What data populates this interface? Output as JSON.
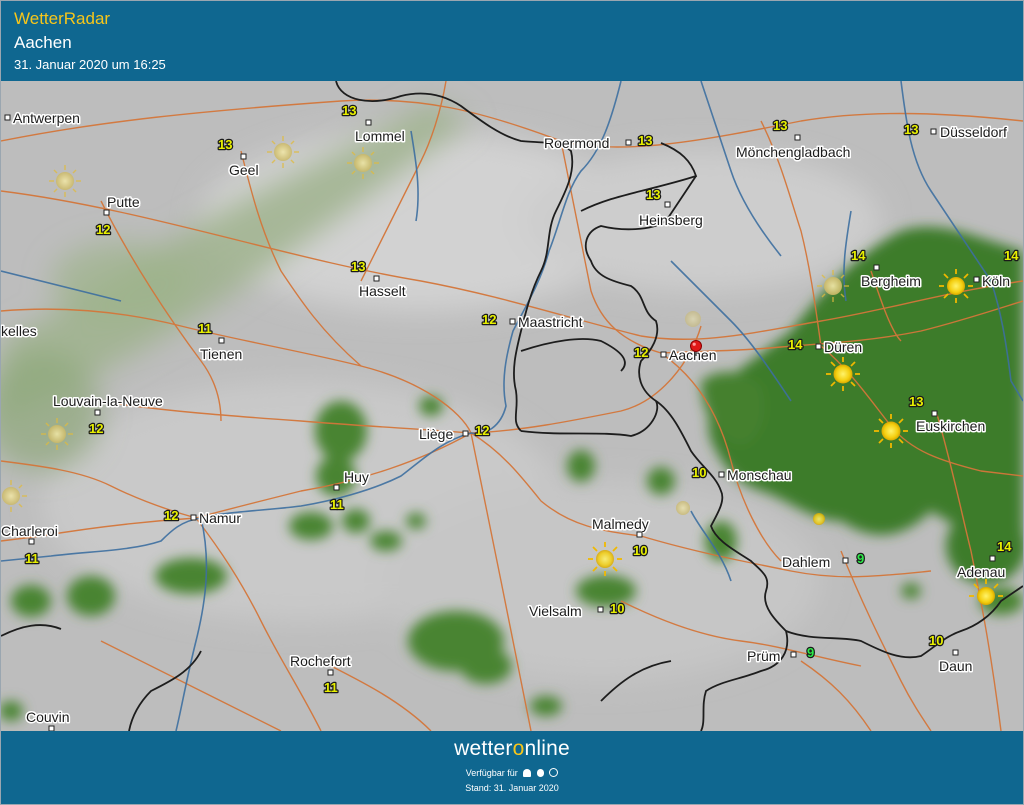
{
  "header": {
    "brand": "WetterRadar",
    "city": "Aachen",
    "datetime": "31. Januar 2020 um 16:25"
  },
  "map": {
    "marker": "Aachen",
    "places": [
      {
        "name": "Antwerpen",
        "temp": null,
        "sun": false
      },
      {
        "name": "Lommel",
        "temp": "13",
        "sun": false
      },
      {
        "name": "Geel",
        "temp": "13",
        "sun": false
      },
      {
        "name": "Putte",
        "temp": "12",
        "sun": false
      },
      {
        "name": "Roermond",
        "temp": "13",
        "sun": false
      },
      {
        "name": "Mönchengladbach",
        "temp": "13",
        "sun": false
      },
      {
        "name": "Düsseldorf",
        "temp": "13",
        "sun": false
      },
      {
        "name": "Heinsberg",
        "temp": "13",
        "sun": false
      },
      {
        "name": "Hasselt",
        "temp": "13",
        "sun": false
      },
      {
        "name": "Bergheim",
        "temp": "14",
        "sun": false
      },
      {
        "name": "Köln",
        "temp": "14",
        "sun": false
      },
      {
        "name": "kelles",
        "temp": null,
        "sun": false
      },
      {
        "name": "Tienen",
        "temp": "11",
        "sun": false
      },
      {
        "name": "Maastricht",
        "temp": "12",
        "sun": false
      },
      {
        "name": "Aachen",
        "temp": "12",
        "sun": false
      },
      {
        "name": "Düren",
        "temp": "14",
        "sun": false
      },
      {
        "name": "Louvain-la-Neuve",
        "temp": "12",
        "sun": false
      },
      {
        "name": "Liège",
        "temp": "12",
        "sun": false
      },
      {
        "name": "Euskirchen",
        "temp": "13",
        "sun": false
      },
      {
        "name": "Huy",
        "temp": "11",
        "sun": false
      },
      {
        "name": "Monschau",
        "temp": "10",
        "sun": false
      },
      {
        "name": "Namur",
        "temp": "12",
        "sun": false
      },
      {
        "name": "Charleroi",
        "temp": "11",
        "sun": false
      },
      {
        "name": "Malmedy",
        "temp": "10",
        "sun": false
      },
      {
        "name": "Dahlem",
        "temp": "9",
        "sun": false
      },
      {
        "name": "Adenau",
        "temp": "14",
        "sun": false
      },
      {
        "name": "Vielsalm",
        "temp": "10",
        "sun": false
      },
      {
        "name": "Prüm",
        "temp": "9",
        "sun": false
      },
      {
        "name": "Daun",
        "temp": "10",
        "sun": false
      },
      {
        "name": "Rochefort",
        "temp": "11",
        "sun": false
      },
      {
        "name": "Couvin",
        "temp": null,
        "sun": false
      }
    ],
    "colors": {
      "land": "#bdbdbd",
      "forest_green": "#3f7c2a",
      "road": "#d4763a",
      "river": "#3d6fa0",
      "border": "#1d1d1d",
      "temp_warm": "#e8f000",
      "temp_cold": "#2ee84a",
      "marker": "#e01818"
    }
  },
  "footer": {
    "logo_part1": "wetter",
    "logo_o": "o",
    "logo_part2": "nline",
    "available_label": "Verfügbar für",
    "stand": "Stand: 31. Januar 2020"
  }
}
